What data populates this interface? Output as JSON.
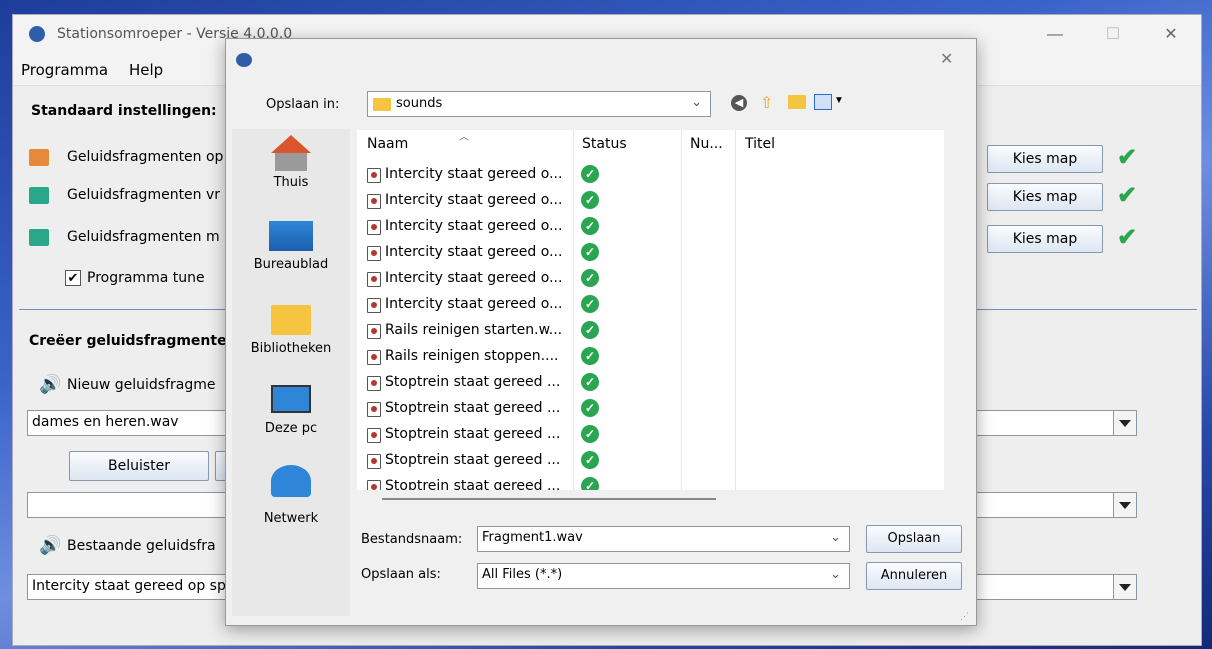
{
  "main": {
    "title": "Stationsomroeper - Versie 4.0.0.0",
    "menu": [
      "Programma",
      "Help"
    ],
    "standard_heading": "Standaard instellingen:",
    "rows": [
      {
        "label": "Geluidsfragmenten op",
        "button": "Kies map"
      },
      {
        "label": "Geluidsfragmenten vr",
        "button": "Kies map"
      },
      {
        "label": "Geluidsfragmenten m",
        "button": "Kies map"
      }
    ],
    "tune_label": "Programma tune",
    "create_heading": "Creëer geluidsfragmenten",
    "new_fragment_label": "Nieuw geluidsfragme",
    "combo1_value": "dames en heren.wav",
    "listen_button": "Beluister",
    "existing_label": "Bestaande geluidsfra",
    "combo3_value": "Intercity staat gereed op sp"
  },
  "dialog": {
    "save_in_label": "Opslaan in:",
    "folder": "sounds",
    "places": [
      "Thuis",
      "Bureaublad",
      "Bibliotheken",
      "Deze pc",
      "Netwerk"
    ],
    "columns": [
      "Naam",
      "Status",
      "Nu...",
      "Titel"
    ],
    "files": [
      "Intercity staat gereed o...",
      "Intercity staat gereed o...",
      "Intercity staat gereed o...",
      "Intercity staat gereed o...",
      "Intercity staat gereed o...",
      "Intercity staat gereed o...",
      "Rails reinigen starten.w...",
      "Rails reinigen stoppen....",
      "Stoptrein staat gereed ...",
      "Stoptrein staat gereed ...",
      "Stoptrein staat gereed ...",
      "Stoptrein staat gereed ...",
      "Stoptrein staat gereed ..."
    ],
    "filename_label": "Bestandsnaam:",
    "filename_value": "Fragment1.wav",
    "filetype_label": "Opslaan als:",
    "filetype_value": "All Files (*.*)",
    "save_button": "Opslaan",
    "cancel_button": "Annuleren"
  }
}
